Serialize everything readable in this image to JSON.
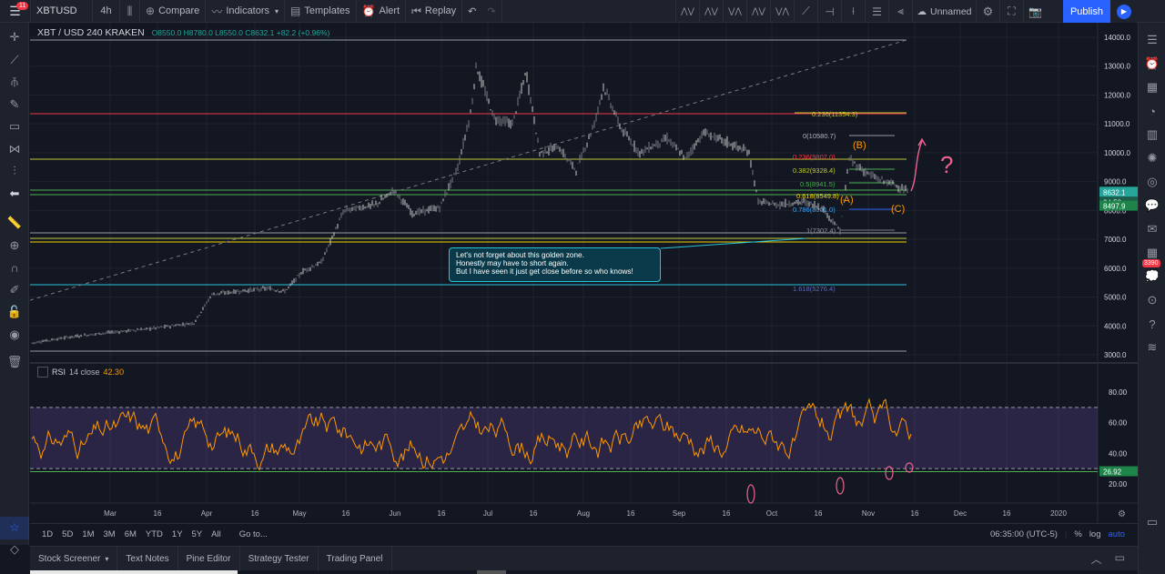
{
  "header": {
    "badge": "11",
    "symbol": "XBTUSD",
    "interval": "4h",
    "compare": "Compare",
    "indicators": "Indicators",
    "templates": "Templates",
    "alert": "Alert",
    "replay": "Replay",
    "layout_name": "Unnamed",
    "publish": "Publish"
  },
  "legend": {
    "name": "XBT / USD  240  KRAKEN",
    "ohlc": "O8550.0  H8780.0  L8550.0  C8632.1  +82.2 (+0.96%)"
  },
  "rsi_legend": {
    "name": "RSI",
    "params": "14 close",
    "value": "42.30"
  },
  "note": {
    "line1": "Let's not forget about this golden zone.",
    "line2": "Honestly may have to short again.",
    "line3": "But I have seen it just get close before so who knows!"
  },
  "annotations": {
    "b": "(B)",
    "a": "(A)",
    "c": "(C)",
    "q": "?"
  },
  "price_axis": [
    "14000.0",
    "13000.0",
    "12000.0",
    "11000.0",
    "10000.0",
    "9000.0",
    "8000.0",
    "7000.0",
    "6000.0",
    "5000.0",
    "4000.0",
    "3000.0"
  ],
  "price_tags": {
    "last": "8632.1",
    "countdown": "24:58",
    "level": "8497.9",
    "rsi": "26.92"
  },
  "rsi_axis": [
    "80.00",
    "60.00",
    "40.00",
    "20.00"
  ],
  "time_axis": [
    "Mar",
    "16",
    "Apr",
    "16",
    "May",
    "16",
    "Jun",
    "16",
    "Jul",
    "16",
    "Aug",
    "16",
    "Sep",
    "16",
    "Oct",
    "16",
    "Nov",
    "16",
    "Dec",
    "16",
    "2020"
  ],
  "fib": {
    "f0236_top": "0.236(11354.3)",
    "f0": "0(10580.7)",
    "f0236": "0.236(9807.0)",
    "f0382": "0.382(9328.4)",
    "f05": "0.5(8941.5)",
    "f0618": "0.618(8549.8)",
    "f0786": "0.786(8001.0)",
    "f1": "1(7302.4)",
    "f1618": "1.618(5276.4)"
  },
  "timeframes": [
    "1D",
    "5D",
    "1M",
    "3M",
    "6M",
    "YTD",
    "1Y",
    "5Y",
    "All"
  ],
  "goto": "Go to...",
  "clock": "06:35:00 (UTC-5)",
  "scale": {
    "pct": "%",
    "log": "log",
    "auto": "auto"
  },
  "bottom_tabs": [
    "Stock Screener",
    "Text Notes",
    "Pine Editor",
    "Strategy Tester",
    "Trading Panel"
  ],
  "right_badge": "3390",
  "colors": {
    "bg": "#131722",
    "panel": "#1e222d",
    "accent": "#2962ff",
    "up": "#26a69a",
    "rsi": "#ff9800",
    "note_border": "#26c6da"
  }
}
